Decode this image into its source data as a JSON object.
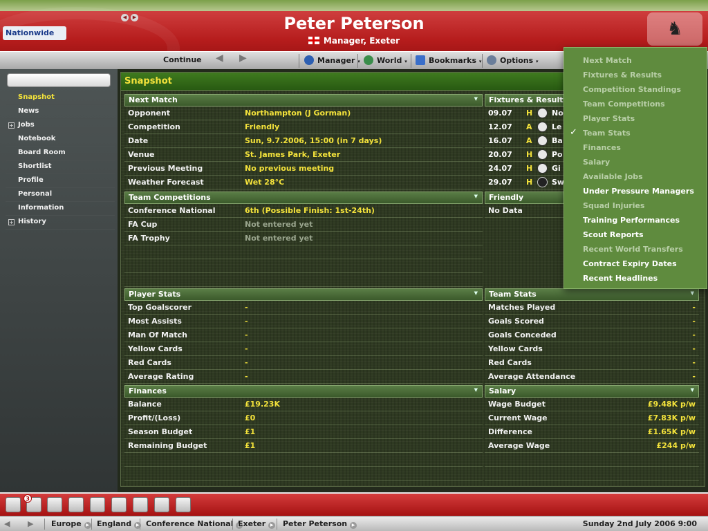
{
  "header": {
    "title": "Peter Peterson",
    "subtitle": "Manager, Exeter",
    "sponsor": "Nationwide"
  },
  "toolbar": {
    "continue_label": "Continue",
    "menus": [
      "Manager",
      "World",
      "Bookmarks",
      "Options"
    ]
  },
  "sidebar": {
    "items": [
      {
        "label": "Snapshot",
        "active": true
      },
      {
        "label": "News"
      },
      {
        "label": "Jobs",
        "expandable": true
      },
      {
        "label": "Notebook"
      },
      {
        "label": "Board Room"
      },
      {
        "label": "Shortlist"
      },
      {
        "label": "Profile"
      },
      {
        "label": "Personal"
      },
      {
        "label": "Information"
      },
      {
        "label": "History",
        "expandable": true
      }
    ]
  },
  "main": {
    "panel_title": "Snapshot",
    "next_match": {
      "title": "Next Match",
      "rows": [
        {
          "k": "Opponent",
          "v": "Northampton (J Gorman)"
        },
        {
          "k": "Competition",
          "v": "Friendly"
        },
        {
          "k": "Date",
          "v": "Sun, 9.7.2006, 15:00 (in 7 days)"
        },
        {
          "k": "Venue",
          "v": "St. James Park, Exeter"
        },
        {
          "k": "Previous Meeting",
          "v": "No previous meeting"
        },
        {
          "k": "Weather Forecast",
          "v": "Wet 28°C"
        }
      ]
    },
    "fixtures": {
      "title": "Fixtures & Results",
      "rows": [
        {
          "date": "09.07",
          "ha": "H",
          "opp": "No"
        },
        {
          "date": "12.07",
          "ha": "A",
          "opp": "Le"
        },
        {
          "date": "16.07",
          "ha": "A",
          "opp": "Ba"
        },
        {
          "date": "20.07",
          "ha": "H",
          "opp": "Po"
        },
        {
          "date": "24.07",
          "ha": "H",
          "opp": "Gi"
        },
        {
          "date": "29.07",
          "ha": "H",
          "opp": "Sw"
        }
      ]
    },
    "team_competitions": {
      "title": "Team Competitions",
      "rows": [
        {
          "k": "Conference National",
          "v": "6th (Possible Finish: 1st-24th)",
          "dim": false
        },
        {
          "k": "FA Cup",
          "v": "Not entered yet",
          "dim": true
        },
        {
          "k": "FA Trophy",
          "v": "Not entered yet",
          "dim": true
        }
      ]
    },
    "friendly": {
      "title": "Friendly",
      "value": "No Data"
    },
    "player_stats": {
      "title": "Player Stats",
      "rows": [
        {
          "k": "Top Goalscorer",
          "v": "-"
        },
        {
          "k": "Most Assists",
          "v": "-"
        },
        {
          "k": "Man Of Match",
          "v": "-"
        },
        {
          "k": "Yellow Cards",
          "v": "-"
        },
        {
          "k": "Red Cards",
          "v": "-"
        },
        {
          "k": "Average Rating",
          "v": "-"
        }
      ]
    },
    "team_stats": {
      "title": "Team Stats",
      "rows": [
        {
          "k": "Matches Played",
          "v": "-"
        },
        {
          "k": "Goals Scored",
          "v": "-"
        },
        {
          "k": "Goals Conceded",
          "v": "-"
        },
        {
          "k": "Yellow Cards",
          "v": "-"
        },
        {
          "k": "Red Cards",
          "v": "-"
        },
        {
          "k": "Average Attendance",
          "v": "-"
        }
      ]
    },
    "finances": {
      "title": "Finances",
      "rows": [
        {
          "k": "Balance",
          "v": "£19.23K"
        },
        {
          "k": "Profit/(Loss)",
          "v": "£0"
        },
        {
          "k": "Season Budget",
          "v": "£1"
        },
        {
          "k": "Remaining Budget",
          "v": "£1"
        }
      ]
    },
    "salary": {
      "title": "Salary",
      "rows": [
        {
          "k": "Wage Budget",
          "v": "£9.48K p/w"
        },
        {
          "k": "Current Wage",
          "v": "£7.83K p/w"
        },
        {
          "k": "Difference",
          "v": "£1.65K p/w"
        },
        {
          "k": "Average Wage",
          "v": "£244 p/w"
        }
      ]
    }
  },
  "menu": {
    "items": [
      {
        "label": "Next Match",
        "enabled": false
      },
      {
        "label": "Fixtures & Results",
        "enabled": false
      },
      {
        "label": "Competition Standings",
        "enabled": false
      },
      {
        "label": "Team Competitions",
        "enabled": false
      },
      {
        "label": "Player Stats",
        "enabled": false
      },
      {
        "label": "Team Stats",
        "enabled": false,
        "checked": true
      },
      {
        "label": "Finances",
        "enabled": false
      },
      {
        "label": "Salary",
        "enabled": false
      },
      {
        "label": "Available Jobs",
        "enabled": false
      },
      {
        "label": "Under Pressure Managers",
        "enabled": true
      },
      {
        "label": "Squad Injuries",
        "enabled": false
      },
      {
        "label": "Training Performances",
        "enabled": true
      },
      {
        "label": "Scout Reports",
        "enabled": true
      },
      {
        "label": "Recent World Transfers",
        "enabled": false
      },
      {
        "label": "Contract Expiry Dates",
        "enabled": true
      },
      {
        "label": "Recent Headlines",
        "enabled": true
      }
    ]
  },
  "dock": {
    "badge": "3"
  },
  "statusbar": {
    "crumbs": [
      "Europe",
      "England",
      "Conference National",
      "Exeter",
      "Peter Peterson"
    ],
    "date": "Sunday 2nd July 2006 9:00"
  },
  "colors": {
    "accent_red": "#b51c1c",
    "highlight_yellow": "#f3e23b",
    "panel_green": "#2f3a22"
  }
}
